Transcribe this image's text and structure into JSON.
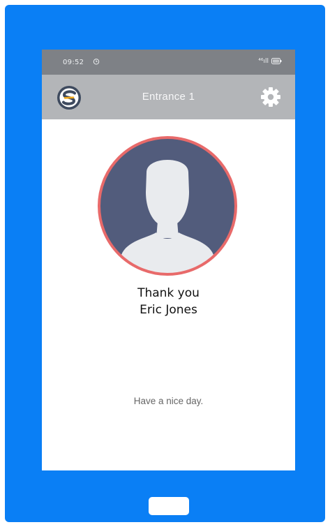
{
  "status_bar": {
    "time": "09:52",
    "signal_text": "⁴⁶ıll",
    "battery_icon": "battery-icon"
  },
  "app_bar": {
    "title": "Entrance 1",
    "logo_icon": "app-logo-icon",
    "settings_icon": "gear-icon"
  },
  "main": {
    "avatar_icon": "user-avatar-icon",
    "greeting": "Thank you",
    "person_name": "Eric Jones",
    "farewell": "Have a nice day."
  },
  "colors": {
    "frame": "#0a7ff5",
    "status_bar": "#7e8186",
    "app_bar": "#b3b5b8",
    "avatar_bg": "#525c7c",
    "avatar_ring": "#e86a6a",
    "silhouette": "#e9ebee",
    "logo_accent": "#f0a81c"
  }
}
